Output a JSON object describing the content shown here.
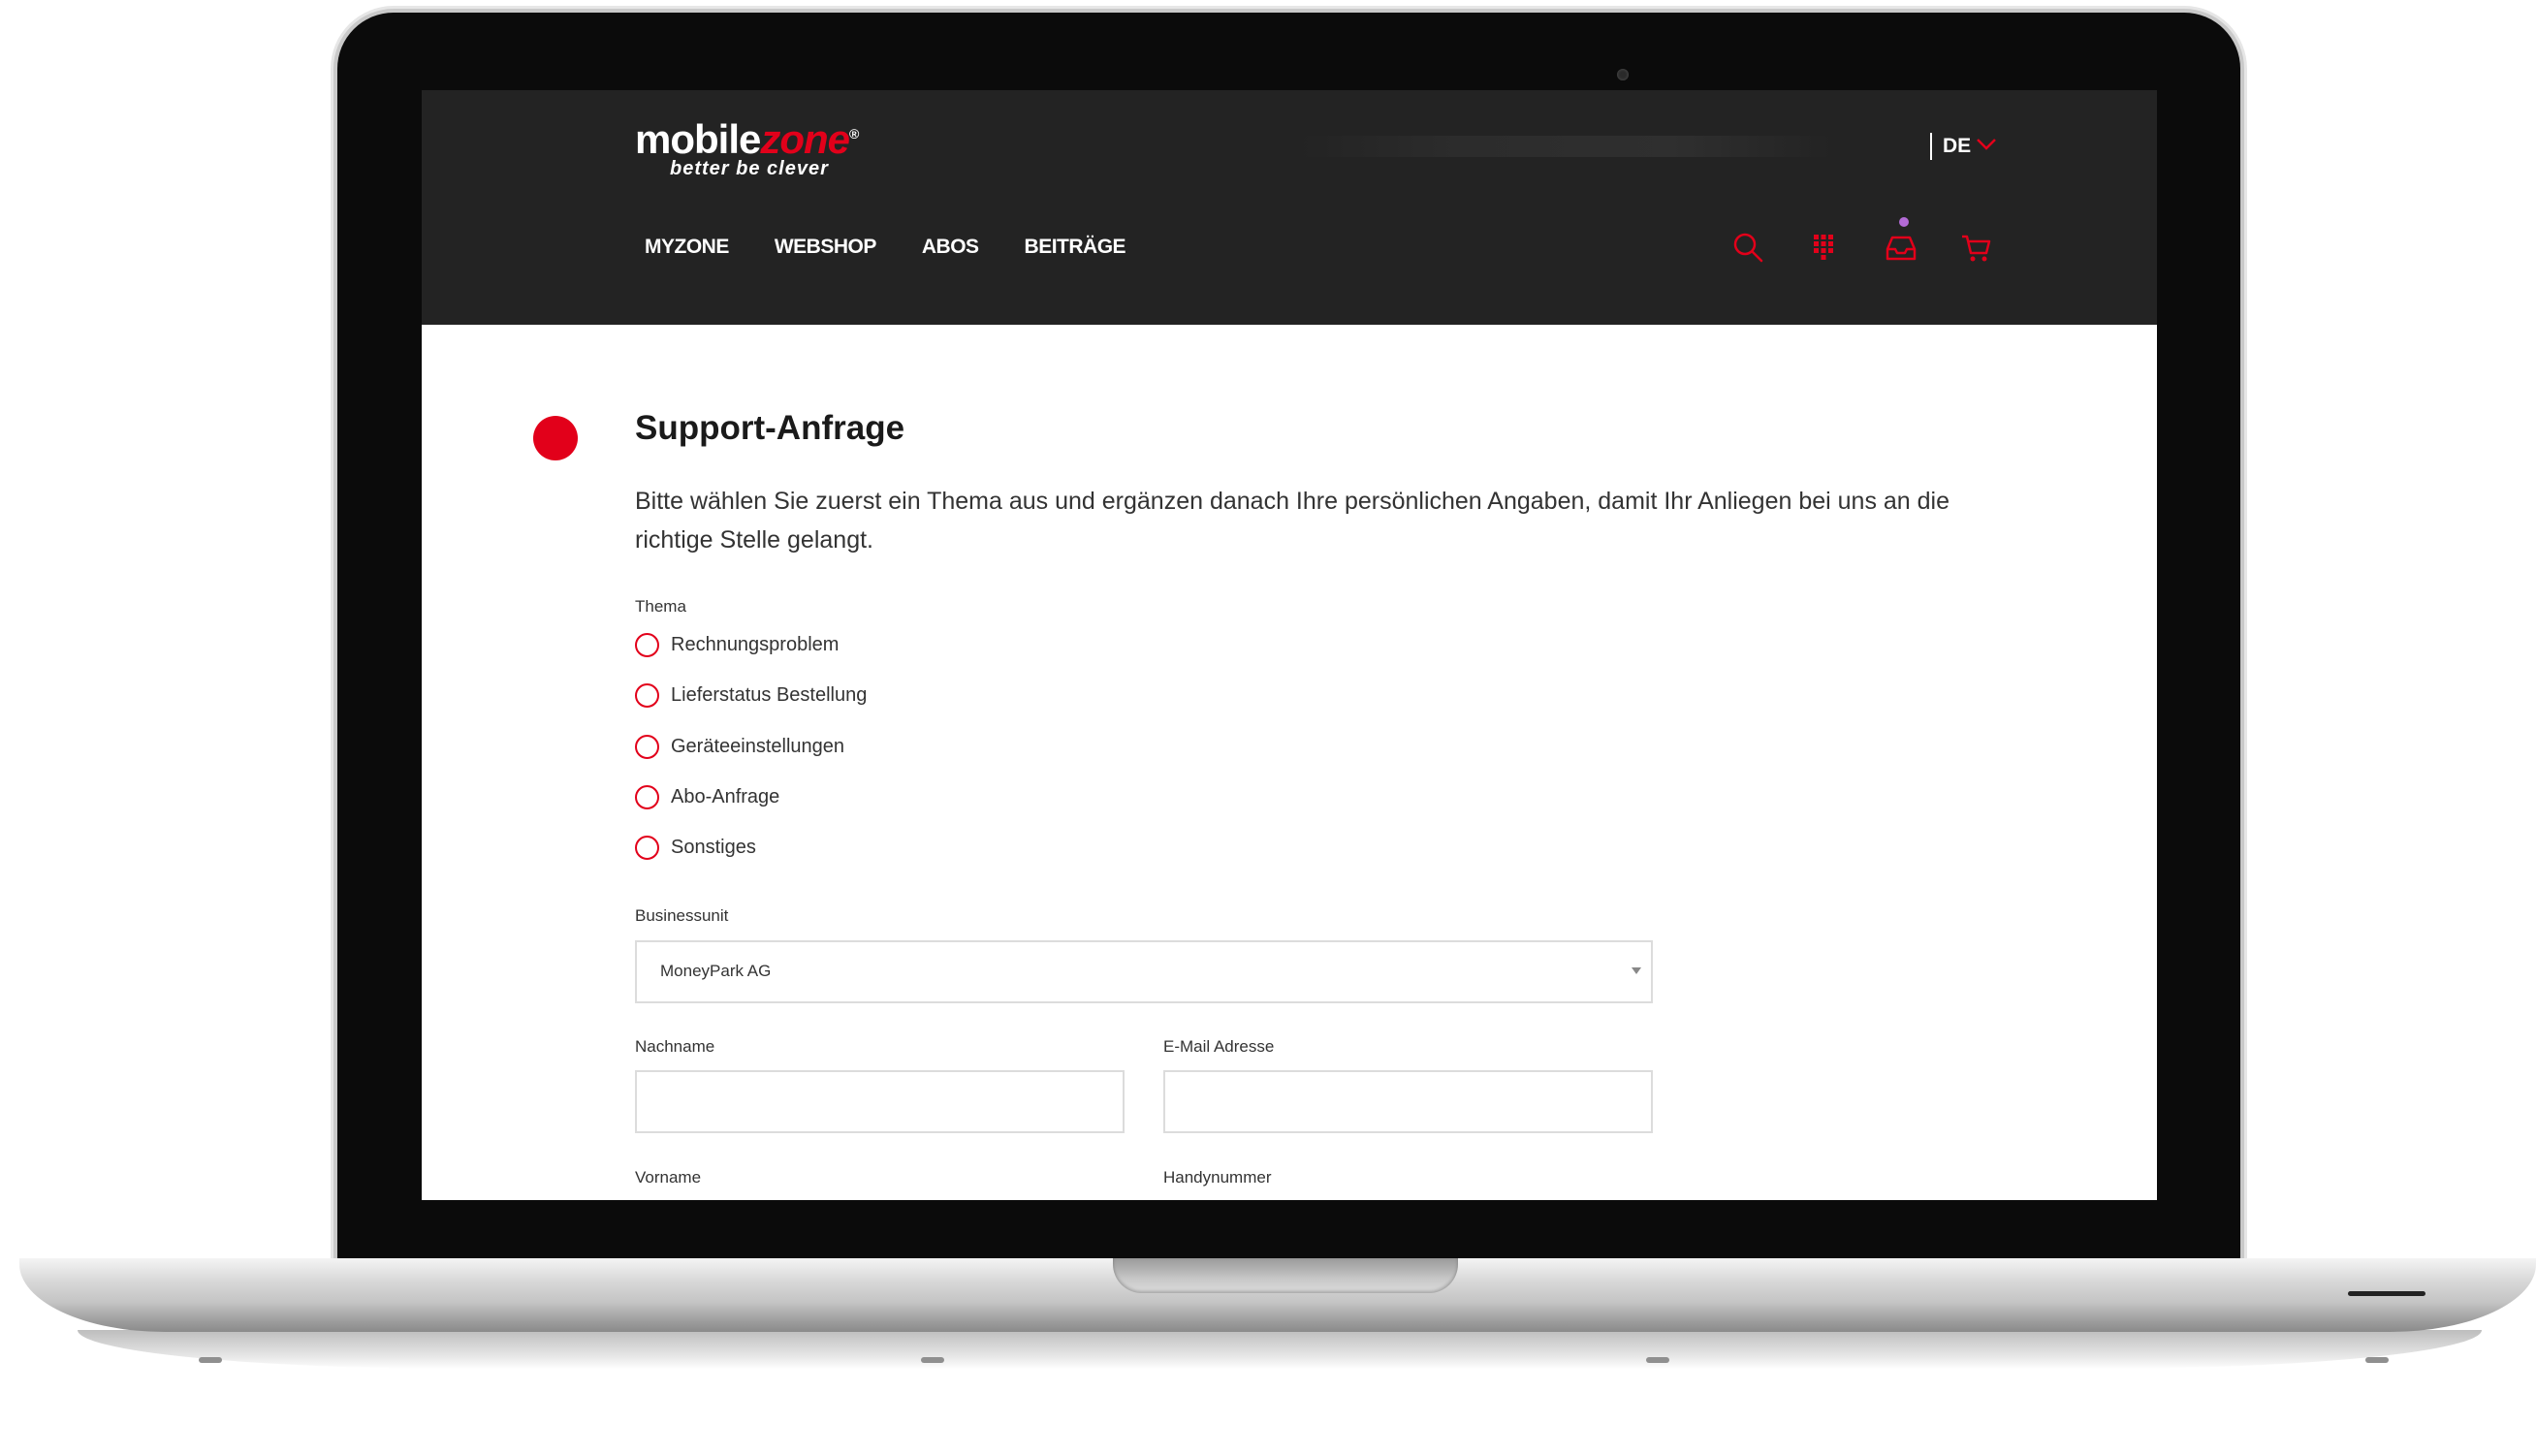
{
  "header": {
    "logo": {
      "brand_white": "mobile",
      "brand_red": "zone",
      "tagline": "better be clever"
    },
    "language": "DE",
    "nav": [
      {
        "label": "MYZONE"
      },
      {
        "label": "WEBSHOP"
      },
      {
        "label": "ABOS"
      },
      {
        "label": "BEITRÄGE"
      }
    ],
    "icons": [
      "search-icon",
      "keypad-icon",
      "inbox-icon",
      "cart-icon"
    ],
    "notification_dot_color": "#b36bd6"
  },
  "main": {
    "title": "Support-Anfrage",
    "intro": "Bitte wählen Sie zuerst ein Thema aus und ergänzen danach Ihre persönlichen Angaben, damit Ihr Anliegen bei uns an die richtige Stelle gelangt.",
    "topic_label": "Thema",
    "topics": [
      {
        "label": "Rechnungsproblem"
      },
      {
        "label": "Lieferstatus Bestellung"
      },
      {
        "label": "Geräteeinstellungen"
      },
      {
        "label": "Abo-Anfrage"
      },
      {
        "label": "Sonstiges"
      }
    ],
    "business_unit_label": "Businessunit",
    "business_unit_value": "MoneyPark AG",
    "fields": {
      "lastname_label": "Nachname",
      "email_label": "E-Mail Adresse",
      "firstname_label": "Vorname",
      "phone_label": "Handynummer"
    }
  },
  "colors": {
    "brand_red": "#e2001a",
    "header_bg": "#232323",
    "text": "#333333"
  }
}
